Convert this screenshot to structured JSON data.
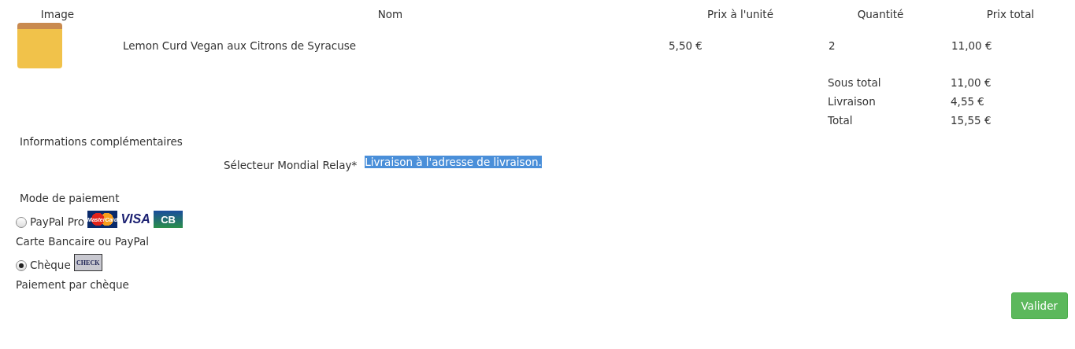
{
  "table": {
    "columns": [
      "Image",
      "Nom",
      "Prix à l'unité",
      "Quantité",
      "Prix total"
    ],
    "rows": [
      {
        "name": "Lemon Curd Vegan aux Citrons de Syracuse",
        "unit_price": "5,50 €",
        "quantity": "2",
        "total": "11,00 €"
      }
    ]
  },
  "summary": [
    {
      "label": "Sous total",
      "value": "11,00 €"
    },
    {
      "label": "Livraison",
      "value": "4,55 €"
    },
    {
      "label": "Total",
      "value": "15,55 €"
    }
  ],
  "extra_info": {
    "heading": "Informations complémentaires",
    "label": "Sélecteur Mondial Relay*",
    "value": "Livraison à l'adresse de livraison.",
    "value_selected": true
  },
  "payment": {
    "heading": "Mode de paiement",
    "methods": [
      {
        "label": "PayPal Pro",
        "description": "Carte Bancaire ou PayPal",
        "selected": false,
        "logos": [
          {
            "kind": "mastercard",
            "text": "MasterCard"
          },
          {
            "kind": "visa",
            "text": "VISA"
          },
          {
            "kind": "cb",
            "text": "CB"
          }
        ]
      },
      {
        "label": "Chèque",
        "description": "Paiement par chèque",
        "selected": true,
        "logos": [
          {
            "kind": "check",
            "text": "CHECK"
          }
        ]
      }
    ]
  },
  "submit": "Valider"
}
